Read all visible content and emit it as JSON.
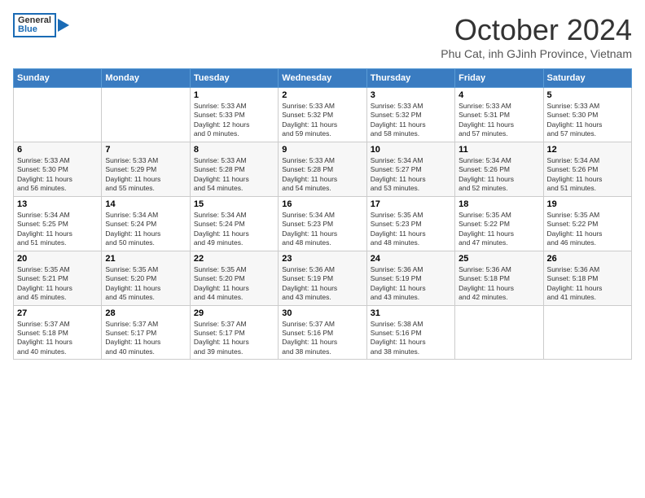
{
  "header": {
    "logo_general": "General",
    "logo_blue": "Blue",
    "month_title": "October 2024",
    "subtitle": "Phu Cat, inh GJinh Province, Vietnam"
  },
  "calendar": {
    "days_of_week": [
      "Sunday",
      "Monday",
      "Tuesday",
      "Wednesday",
      "Thursday",
      "Friday",
      "Saturday"
    ],
    "weeks": [
      [
        {
          "day": "",
          "info": ""
        },
        {
          "day": "",
          "info": ""
        },
        {
          "day": "1",
          "info": "Sunrise: 5:33 AM\nSunset: 5:33 PM\nDaylight: 12 hours\nand 0 minutes."
        },
        {
          "day": "2",
          "info": "Sunrise: 5:33 AM\nSunset: 5:32 PM\nDaylight: 11 hours\nand 59 minutes."
        },
        {
          "day": "3",
          "info": "Sunrise: 5:33 AM\nSunset: 5:32 PM\nDaylight: 11 hours\nand 58 minutes."
        },
        {
          "day": "4",
          "info": "Sunrise: 5:33 AM\nSunset: 5:31 PM\nDaylight: 11 hours\nand 57 minutes."
        },
        {
          "day": "5",
          "info": "Sunrise: 5:33 AM\nSunset: 5:30 PM\nDaylight: 11 hours\nand 57 minutes."
        }
      ],
      [
        {
          "day": "6",
          "info": "Sunrise: 5:33 AM\nSunset: 5:30 PM\nDaylight: 11 hours\nand 56 minutes."
        },
        {
          "day": "7",
          "info": "Sunrise: 5:33 AM\nSunset: 5:29 PM\nDaylight: 11 hours\nand 55 minutes."
        },
        {
          "day": "8",
          "info": "Sunrise: 5:33 AM\nSunset: 5:28 PM\nDaylight: 11 hours\nand 54 minutes."
        },
        {
          "day": "9",
          "info": "Sunrise: 5:33 AM\nSunset: 5:28 PM\nDaylight: 11 hours\nand 54 minutes."
        },
        {
          "day": "10",
          "info": "Sunrise: 5:34 AM\nSunset: 5:27 PM\nDaylight: 11 hours\nand 53 minutes."
        },
        {
          "day": "11",
          "info": "Sunrise: 5:34 AM\nSunset: 5:26 PM\nDaylight: 11 hours\nand 52 minutes."
        },
        {
          "day": "12",
          "info": "Sunrise: 5:34 AM\nSunset: 5:26 PM\nDaylight: 11 hours\nand 51 minutes."
        }
      ],
      [
        {
          "day": "13",
          "info": "Sunrise: 5:34 AM\nSunset: 5:25 PM\nDaylight: 11 hours\nand 51 minutes."
        },
        {
          "day": "14",
          "info": "Sunrise: 5:34 AM\nSunset: 5:24 PM\nDaylight: 11 hours\nand 50 minutes."
        },
        {
          "day": "15",
          "info": "Sunrise: 5:34 AM\nSunset: 5:24 PM\nDaylight: 11 hours\nand 49 minutes."
        },
        {
          "day": "16",
          "info": "Sunrise: 5:34 AM\nSunset: 5:23 PM\nDaylight: 11 hours\nand 48 minutes."
        },
        {
          "day": "17",
          "info": "Sunrise: 5:35 AM\nSunset: 5:23 PM\nDaylight: 11 hours\nand 48 minutes."
        },
        {
          "day": "18",
          "info": "Sunrise: 5:35 AM\nSunset: 5:22 PM\nDaylight: 11 hours\nand 47 minutes."
        },
        {
          "day": "19",
          "info": "Sunrise: 5:35 AM\nSunset: 5:22 PM\nDaylight: 11 hours\nand 46 minutes."
        }
      ],
      [
        {
          "day": "20",
          "info": "Sunrise: 5:35 AM\nSunset: 5:21 PM\nDaylight: 11 hours\nand 45 minutes."
        },
        {
          "day": "21",
          "info": "Sunrise: 5:35 AM\nSunset: 5:20 PM\nDaylight: 11 hours\nand 45 minutes."
        },
        {
          "day": "22",
          "info": "Sunrise: 5:35 AM\nSunset: 5:20 PM\nDaylight: 11 hours\nand 44 minutes."
        },
        {
          "day": "23",
          "info": "Sunrise: 5:36 AM\nSunset: 5:19 PM\nDaylight: 11 hours\nand 43 minutes."
        },
        {
          "day": "24",
          "info": "Sunrise: 5:36 AM\nSunset: 5:19 PM\nDaylight: 11 hours\nand 43 minutes."
        },
        {
          "day": "25",
          "info": "Sunrise: 5:36 AM\nSunset: 5:18 PM\nDaylight: 11 hours\nand 42 minutes."
        },
        {
          "day": "26",
          "info": "Sunrise: 5:36 AM\nSunset: 5:18 PM\nDaylight: 11 hours\nand 41 minutes."
        }
      ],
      [
        {
          "day": "27",
          "info": "Sunrise: 5:37 AM\nSunset: 5:18 PM\nDaylight: 11 hours\nand 40 minutes."
        },
        {
          "day": "28",
          "info": "Sunrise: 5:37 AM\nSunset: 5:17 PM\nDaylight: 11 hours\nand 40 minutes."
        },
        {
          "day": "29",
          "info": "Sunrise: 5:37 AM\nSunset: 5:17 PM\nDaylight: 11 hours\nand 39 minutes."
        },
        {
          "day": "30",
          "info": "Sunrise: 5:37 AM\nSunset: 5:16 PM\nDaylight: 11 hours\nand 38 minutes."
        },
        {
          "day": "31",
          "info": "Sunrise: 5:38 AM\nSunset: 5:16 PM\nDaylight: 11 hours\nand 38 minutes."
        },
        {
          "day": "",
          "info": ""
        },
        {
          "day": "",
          "info": ""
        }
      ]
    ]
  }
}
